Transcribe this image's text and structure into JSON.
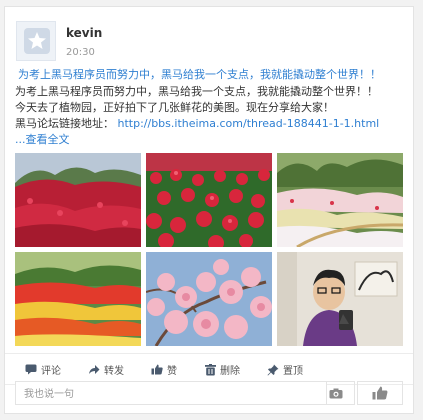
{
  "post": {
    "username": "kevin",
    "time": "20:30",
    "title_line": "为考上黑马程序员而努力中，黑马给我一个支点，我就能撬动整个世界！！",
    "line1": "为考上黑马程序员而努力中，黑马给我一个支点，我就能撬动整个世界！！",
    "line2": "今天去了植物园，正好拍下了几张鲜花的美图。现在分享给大家！",
    "link_prefix": "黑马论坛链接地址：",
    "link_url": "http://bbs.itheima.com/thread-188441-1-1.html",
    "more": "...查看全文"
  },
  "photos": [
    "red-tulips",
    "red-tulip-field",
    "garden-flowerbeds",
    "tulip-garden",
    "peach-blossoms",
    "selfie"
  ],
  "actions": {
    "comment": "评论",
    "forward": "转发",
    "like": "赞",
    "delete": "删除",
    "pin": "置顶"
  },
  "comment_box": {
    "placeholder": "我也说一句"
  },
  "icons": [
    "avatar-star-icon",
    "comment-icon",
    "forward-icon",
    "like-icon",
    "delete-icon",
    "pin-icon",
    "camera-icon",
    "thumb-icon"
  ]
}
